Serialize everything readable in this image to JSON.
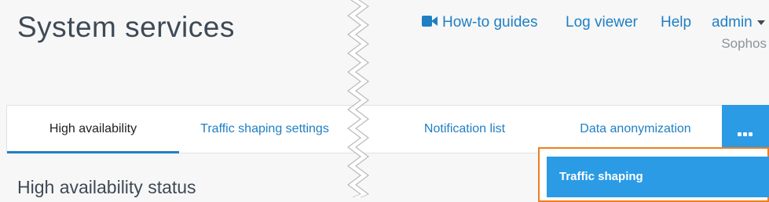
{
  "page": {
    "title": "System services"
  },
  "header": {
    "links": [
      {
        "label": "How-to guides",
        "icon": "video-camera-icon"
      },
      {
        "label": "Log viewer"
      },
      {
        "label": "Help"
      }
    ],
    "user": {
      "label": "admin",
      "org": "Sophos"
    }
  },
  "tabs": [
    {
      "label": "High availability",
      "active": true
    },
    {
      "label": "Traffic shaping settings",
      "active": false
    },
    {
      "label": "Notification list",
      "active": false
    },
    {
      "label": "Data anonymization",
      "active": false
    }
  ],
  "more_menu": {
    "icon": "more-dots-icon",
    "items": [
      {
        "label": "Traffic shaping",
        "highlighted": true
      }
    ]
  },
  "main": {
    "section_heading": "High availability status"
  },
  "colors": {
    "link": "#1f7fc4",
    "accent": "#2b9be5",
    "highlight_border": "#f07d1f",
    "title": "#3e4a56"
  }
}
